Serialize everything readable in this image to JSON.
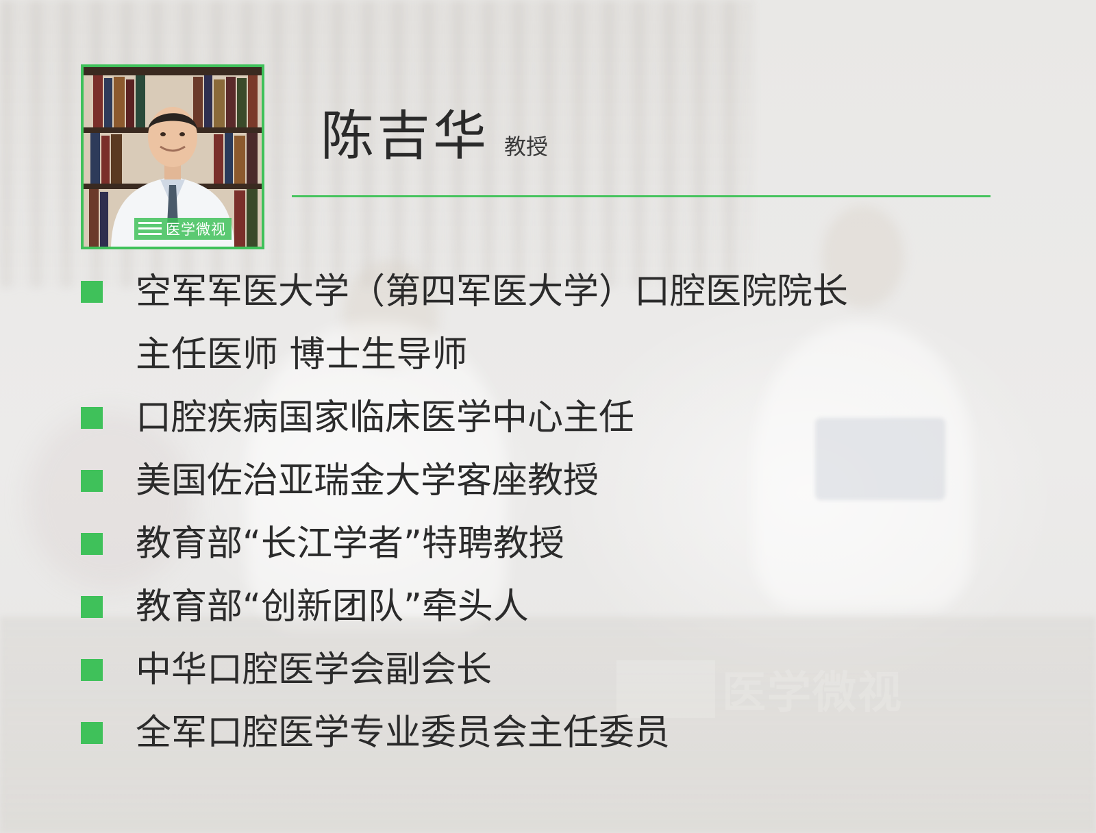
{
  "profile": {
    "name": "陈吉华",
    "title": "教授"
  },
  "portrait": {
    "logo_text": "医学微视"
  },
  "watermark": {
    "text": "医学微视"
  },
  "credentials": [
    {
      "lines": [
        "空军军医大学（第四军医大学）口腔医院院长",
        "主任医师 博士生导师"
      ]
    },
    {
      "lines": [
        "口腔疾病国家临床医学中心主任"
      ]
    },
    {
      "lines": [
        "美国佐治亚瑞金大学客座教授"
      ]
    },
    {
      "lines": [
        "教育部“长江学者”特聘教授"
      ]
    },
    {
      "lines": [
        "教育部“创新团队”牵头人"
      ]
    },
    {
      "lines": [
        "中华口腔医学会副会长"
      ]
    },
    {
      "lines": [
        "全军口腔医学专业委员会主任委员"
      ]
    }
  ],
  "colors": {
    "accent_green": "#3fc15a"
  }
}
